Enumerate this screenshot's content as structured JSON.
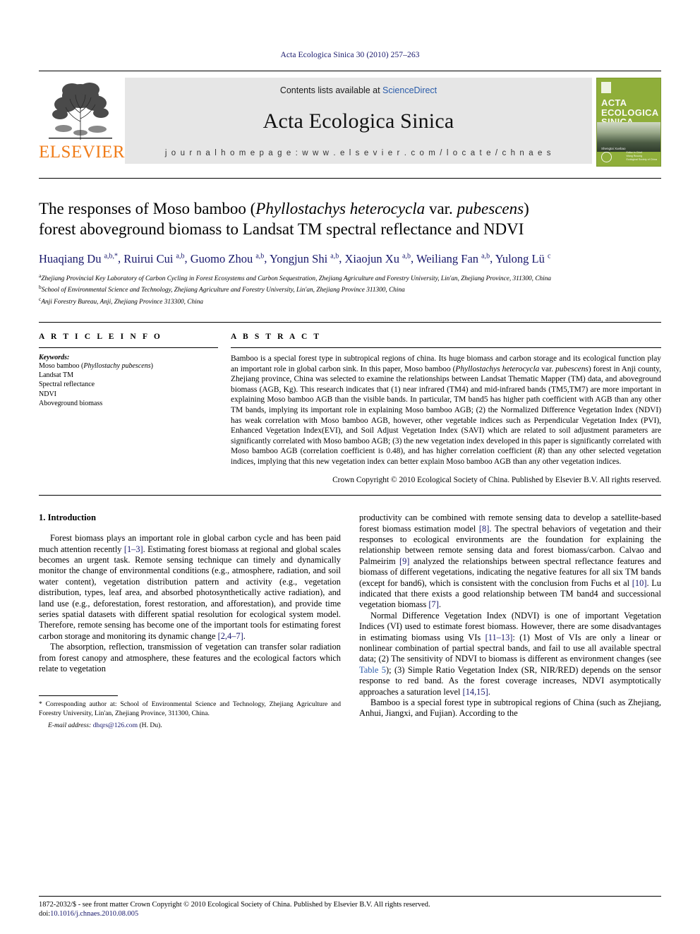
{
  "running_head": "Acta Ecologica Sinica 30 (2010) 257–263",
  "masthead": {
    "publisher": "ELSEVIER",
    "contents_prefix": "Contents lists available at ",
    "contents_link": "ScienceDirect",
    "journal_name": "Acta Ecologica Sinica",
    "homepage": "j o u r n a l   h o m e p a g e :   w w w . e l s e v i e r . c o m / l o c a t e / c h n a e s",
    "cover": {
      "title_line1": "ACTA",
      "title_line2": "ECOLOGICA",
      "title_line3": "SINICA",
      "subtitle": "Shengtai Xuebao",
      "foot_line1": "Editor in Chief",
      "foot_line2": "Wang Rusong",
      "foot_line3": "Ecological Society of China",
      "background_color": "#8fae3a"
    }
  },
  "article": {
    "title_part1": "The responses of Moso bamboo (",
    "title_italic1": "Phyllostachys heterocycla",
    "title_part2": " var. ",
    "title_italic2": "pubescens",
    "title_part3": ")",
    "title_line2": "forest aboveground biomass to Landsat TM spectral reflectance and NDVI",
    "authors": [
      {
        "name": "Huaqiang Du",
        "sup": "a,b,*"
      },
      {
        "name": "Ruirui Cui",
        "sup": "a,b"
      },
      {
        "name": "Guomo Zhou",
        "sup": "a,b"
      },
      {
        "name": "Yongjun Shi",
        "sup": "a,b"
      },
      {
        "name": "Xiaojun Xu",
        "sup": "a,b"
      },
      {
        "name": "Weiliang Fan",
        "sup": "a,b"
      },
      {
        "name": "Yulong Lü",
        "sup": "c"
      }
    ],
    "affiliations": [
      {
        "marker": "a",
        "text": "Zhejiang Provincial Key Laboratory of Carbon Cycling in Forest Ecosystems and Carbon Sequestration, Zhejiang Agriculture and Forestry University, Lin'an, Zhejiang Province, 311300, China"
      },
      {
        "marker": "b",
        "text": "School of Environmental Science and Technology, Zhejiang Agriculture and Forestry University, Lin'an, Zhejiang Province 311300, China"
      },
      {
        "marker": "c",
        "text": "Anji Forestry Bureau, Anji, Zhejiang Province 313300, China"
      }
    ]
  },
  "article_info": {
    "heading": "A R T I C L E   I N F O",
    "keywords_heading": "Keywords:",
    "keywords": [
      {
        "text_before": "Moso bamboo (",
        "italic": "Phyllostachy pubescens",
        "text_after": ")"
      },
      {
        "text_before": "Landsat TM",
        "italic": "",
        "text_after": ""
      },
      {
        "text_before": "Spectral reflectance",
        "italic": "",
        "text_after": ""
      },
      {
        "text_before": "NDVI",
        "italic": "",
        "text_after": ""
      },
      {
        "text_before": "Aboveground biomass",
        "italic": "",
        "text_after": ""
      }
    ]
  },
  "abstract": {
    "heading": "A B S T R A C T",
    "seg1": "Bamboo is a special forest type in subtropical regions of china. Its huge biomass and carbon storage and its ecological function play an important role in global carbon sink. In this paper, Moso bamboo (",
    "seg_italic1": "Phyllostachys heterocycla",
    "seg2": " var. ",
    "seg_italic2": "pubescens",
    "seg3": ") forest in Anji county, Zhejiang province, China was selected to examine the relationships between Landsat Thematic Mapper (TM) data, and aboveground biomass (AGB, Kg). This research indicates that (1) near infrared (TM4) and mid-infrared bands (TM5,TM7) are more important in explaining Moso bamboo AGB than the visible bands. In particular, TM band5 has higher path coefficient with AGB than any other TM bands, implying its important role in explaining Moso bamboo AGB; (2) the Normalized Difference Vegetation Index (NDVI) has weak correlation with Moso bamboo AGB, however, other vegetable indices such as Perpendicular Vegetation Index (PVI), Enhanced Vegetation Index(EVI), and Soil Adjust Vegetation Index (SAVI) which are related to soil adjustment parameters are significantly correlated with Moso bamboo AGB; (3) the new vegetation index developed in this paper is significantly correlated with Moso bamboo AGB (correlation coefficient is 0.48), and has higher correlation coefficient (",
    "seg_italic3": "R",
    "seg4": ") than any other selected vegetation indices, implying that this new vegetation index can better explain Moso bamboo AGB than any other vegetation indices.",
    "copyright": "Crown Copyright © 2010 Ecological Society of China. Published by Elsevier B.V. All rights reserved."
  },
  "introduction": {
    "heading": "1. Introduction",
    "p1_a": "Forest biomass plays an important role in global carbon cycle and has been paid much attention recently ",
    "p1_ref1": "[1–3]",
    "p1_b": ". Estimating forest biomass at regional and global scales becomes an urgent task. Remote sensing technique can timely and dynamically monitor the change of environmental conditions (e.g., atmosphere, radiation, and soil water content), vegetation distribution pattern and activity (e.g., vegetation distribution, types, leaf area, and absorbed photosynthetically active radiation), and land use (e.g., deforestation, forest restoration, and afforestation), and provide time series spatial datasets with different spatial resolution for ecological system model. Therefore, remote sensing has become one of the important tools for estimating forest carbon storage and monitoring its dynamic change ",
    "p1_ref2": "[2,4–7]",
    "p1_c": ".",
    "p2": "The absorption, reflection, transmission of vegetation can transfer solar radiation from forest canopy and atmosphere, these features and the ecological factors which relate to vegetation",
    "p3_a": "productivity can be combined with remote sensing data to develop a satellite-based forest biomass estimation model ",
    "p3_ref1": "[8]",
    "p3_b": ". The spectral behaviors of vegetation and their responses to ecological environments are the foundation for explaining the relationship between remote sensing data and forest biomass/carbon. Calvao and Palmeirim ",
    "p3_ref2": "[9]",
    "p3_c": " analyzed the relationships between spectral reflectance features and biomass of different vegetations, indicating the negative features for all six TM bands (except for band6), which is consistent with the conclusion from Fuchs et al ",
    "p3_ref3": "[10]",
    "p3_d": ". Lu indicated that there exists a good relationship between TM band4 and successional vegetation biomass ",
    "p3_ref4": "[7]",
    "p3_e": ".",
    "p4_a": "Normal Difference Vegetation Index (NDVI) is one of important Vegetation Indices (VI) used to estimate forest biomass. However, there are some disadvantages in estimating biomass using VIs ",
    "p4_ref1": "[11–13]",
    "p4_b": ": (1) Most of VIs are only a linear or nonlinear combination of partial spectral bands, and fail to use all available spectral data; (2) The sensitivity of NDVI to biomass is different as environment changes (see ",
    "p4_table_ref": "Table 5",
    "p4_c": "); (3) Simple Ratio Vegetation Index (SR, NIR/RED) depends on the sensor response to red band. As the forest coverage increases, NDVI asymptotically approaches a saturation level ",
    "p4_ref2": "[14,15]",
    "p4_d": ".",
    "p5": "Bamboo is a special forest type in subtropical regions of China (such as Zhejiang, Anhui, Jiangxi, and Fujian). According to the"
  },
  "footnote": {
    "corresponding_marker": "*",
    "corresponding_text": " Corresponding author at: School of Environmental Science and Technology, Zhejiang Agriculture and Forestry University, Lin'an, Zhejiang Province, 311300, China.",
    "email_label": "E-mail address:",
    "email_address": "dhqrs@126.com",
    "email_suffix": " (H. Du)."
  },
  "footer": {
    "issn_line": "1872-2032/$ - see front matter Crown Copyright © 2010 Ecological Society of China. Published by Elsevier B.V. All rights reserved.",
    "doi_prefix": "doi:",
    "doi_value": "10.1016/j.chnaes.2010.08.005"
  }
}
